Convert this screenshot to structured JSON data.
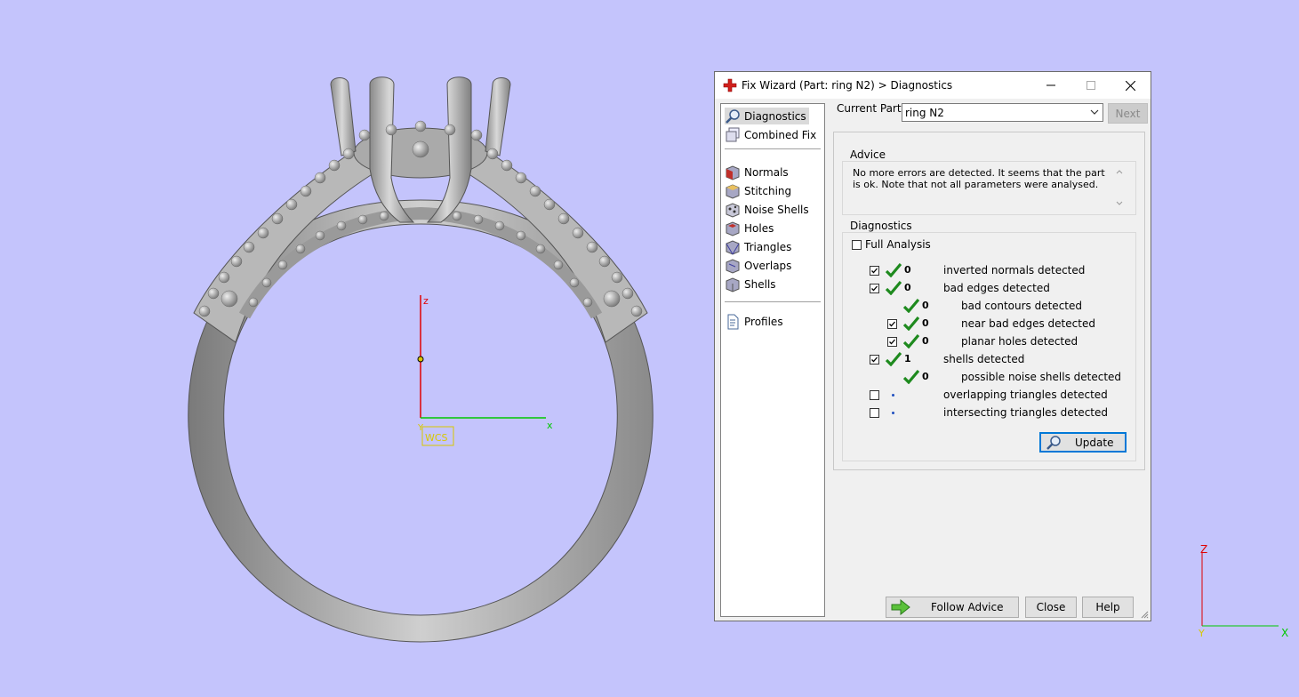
{
  "viewport": {
    "main_axes": {
      "z_label": "z",
      "x_label": "x",
      "y_label": "Y",
      "wcs_label": "WCS"
    },
    "corner_axes": {
      "z_label": "Z",
      "x_label": "X",
      "y_label": "Y"
    },
    "colors": {
      "background": "#c4c4fc",
      "x_axis": "#00c800",
      "z_axis": "#e00000",
      "wcs": "#d8c800"
    }
  },
  "dialog": {
    "title": "Fix Wizard (Part: ring N2) > Diagnostics",
    "nav": [
      {
        "label": "Diagnostics",
        "icon": "diagnostics-magnifier-icon",
        "selected": true
      },
      {
        "label": "Combined Fix",
        "icon": "combined-fix-icon"
      },
      {
        "label": "Normals",
        "icon": "normals-cube-icon"
      },
      {
        "label": "Stitching",
        "icon": "stitching-cube-icon"
      },
      {
        "label": "Noise Shells",
        "icon": "noise-shells-icon"
      },
      {
        "label": "Holes",
        "icon": "holes-cube-icon"
      },
      {
        "label": "Triangles",
        "icon": "triangles-cube-icon"
      },
      {
        "label": "Overlaps",
        "icon": "overlaps-cube-icon"
      },
      {
        "label": "Shells",
        "icon": "shells-cube-icon"
      },
      {
        "label": "Profiles",
        "icon": "profiles-document-icon"
      }
    ],
    "current_part_label": "Current Part:",
    "current_part_value": "ring N2",
    "next_label": "Next",
    "advice_legend": "Advice",
    "advice_text": "No more errors are detected. It seems that the part is ok. Note that not all parameters were analysed.",
    "diagnostics_legend": "Diagnostics",
    "full_analysis_label": "Full Analysis",
    "full_analysis_checked": false,
    "rows": [
      {
        "label": "inverted normals detected",
        "count": "0",
        "checkbox": true,
        "checked": true,
        "status": "ok",
        "indent": 0
      },
      {
        "label": "bad edges detected",
        "count": "0",
        "checkbox": true,
        "checked": true,
        "status": "ok",
        "indent": 0
      },
      {
        "label": "bad contours detected",
        "count": "0",
        "checkbox": false,
        "checked": false,
        "status": "ok",
        "indent": 1
      },
      {
        "label": "near bad edges detected",
        "count": "0",
        "checkbox": true,
        "checked": true,
        "status": "ok",
        "indent": 1
      },
      {
        "label": "planar holes detected",
        "count": "0",
        "checkbox": true,
        "checked": true,
        "status": "ok",
        "indent": 1
      },
      {
        "label": "shells detected",
        "count": "1",
        "checkbox": true,
        "checked": true,
        "status": "ok",
        "indent": 0
      },
      {
        "label": "possible noise shells detected",
        "count": "0",
        "checkbox": false,
        "checked": false,
        "status": "ok",
        "indent": 1
      },
      {
        "label": "overlapping triangles detected",
        "count": "",
        "checkbox": true,
        "checked": false,
        "status": "pending",
        "indent": 0
      },
      {
        "label": "intersecting triangles detected",
        "count": "",
        "checkbox": true,
        "checked": false,
        "status": "pending",
        "indent": 0
      }
    ],
    "update_label": "Update",
    "follow_advice_label": "Follow Advice",
    "close_label": "Close",
    "help_label": "Help"
  }
}
